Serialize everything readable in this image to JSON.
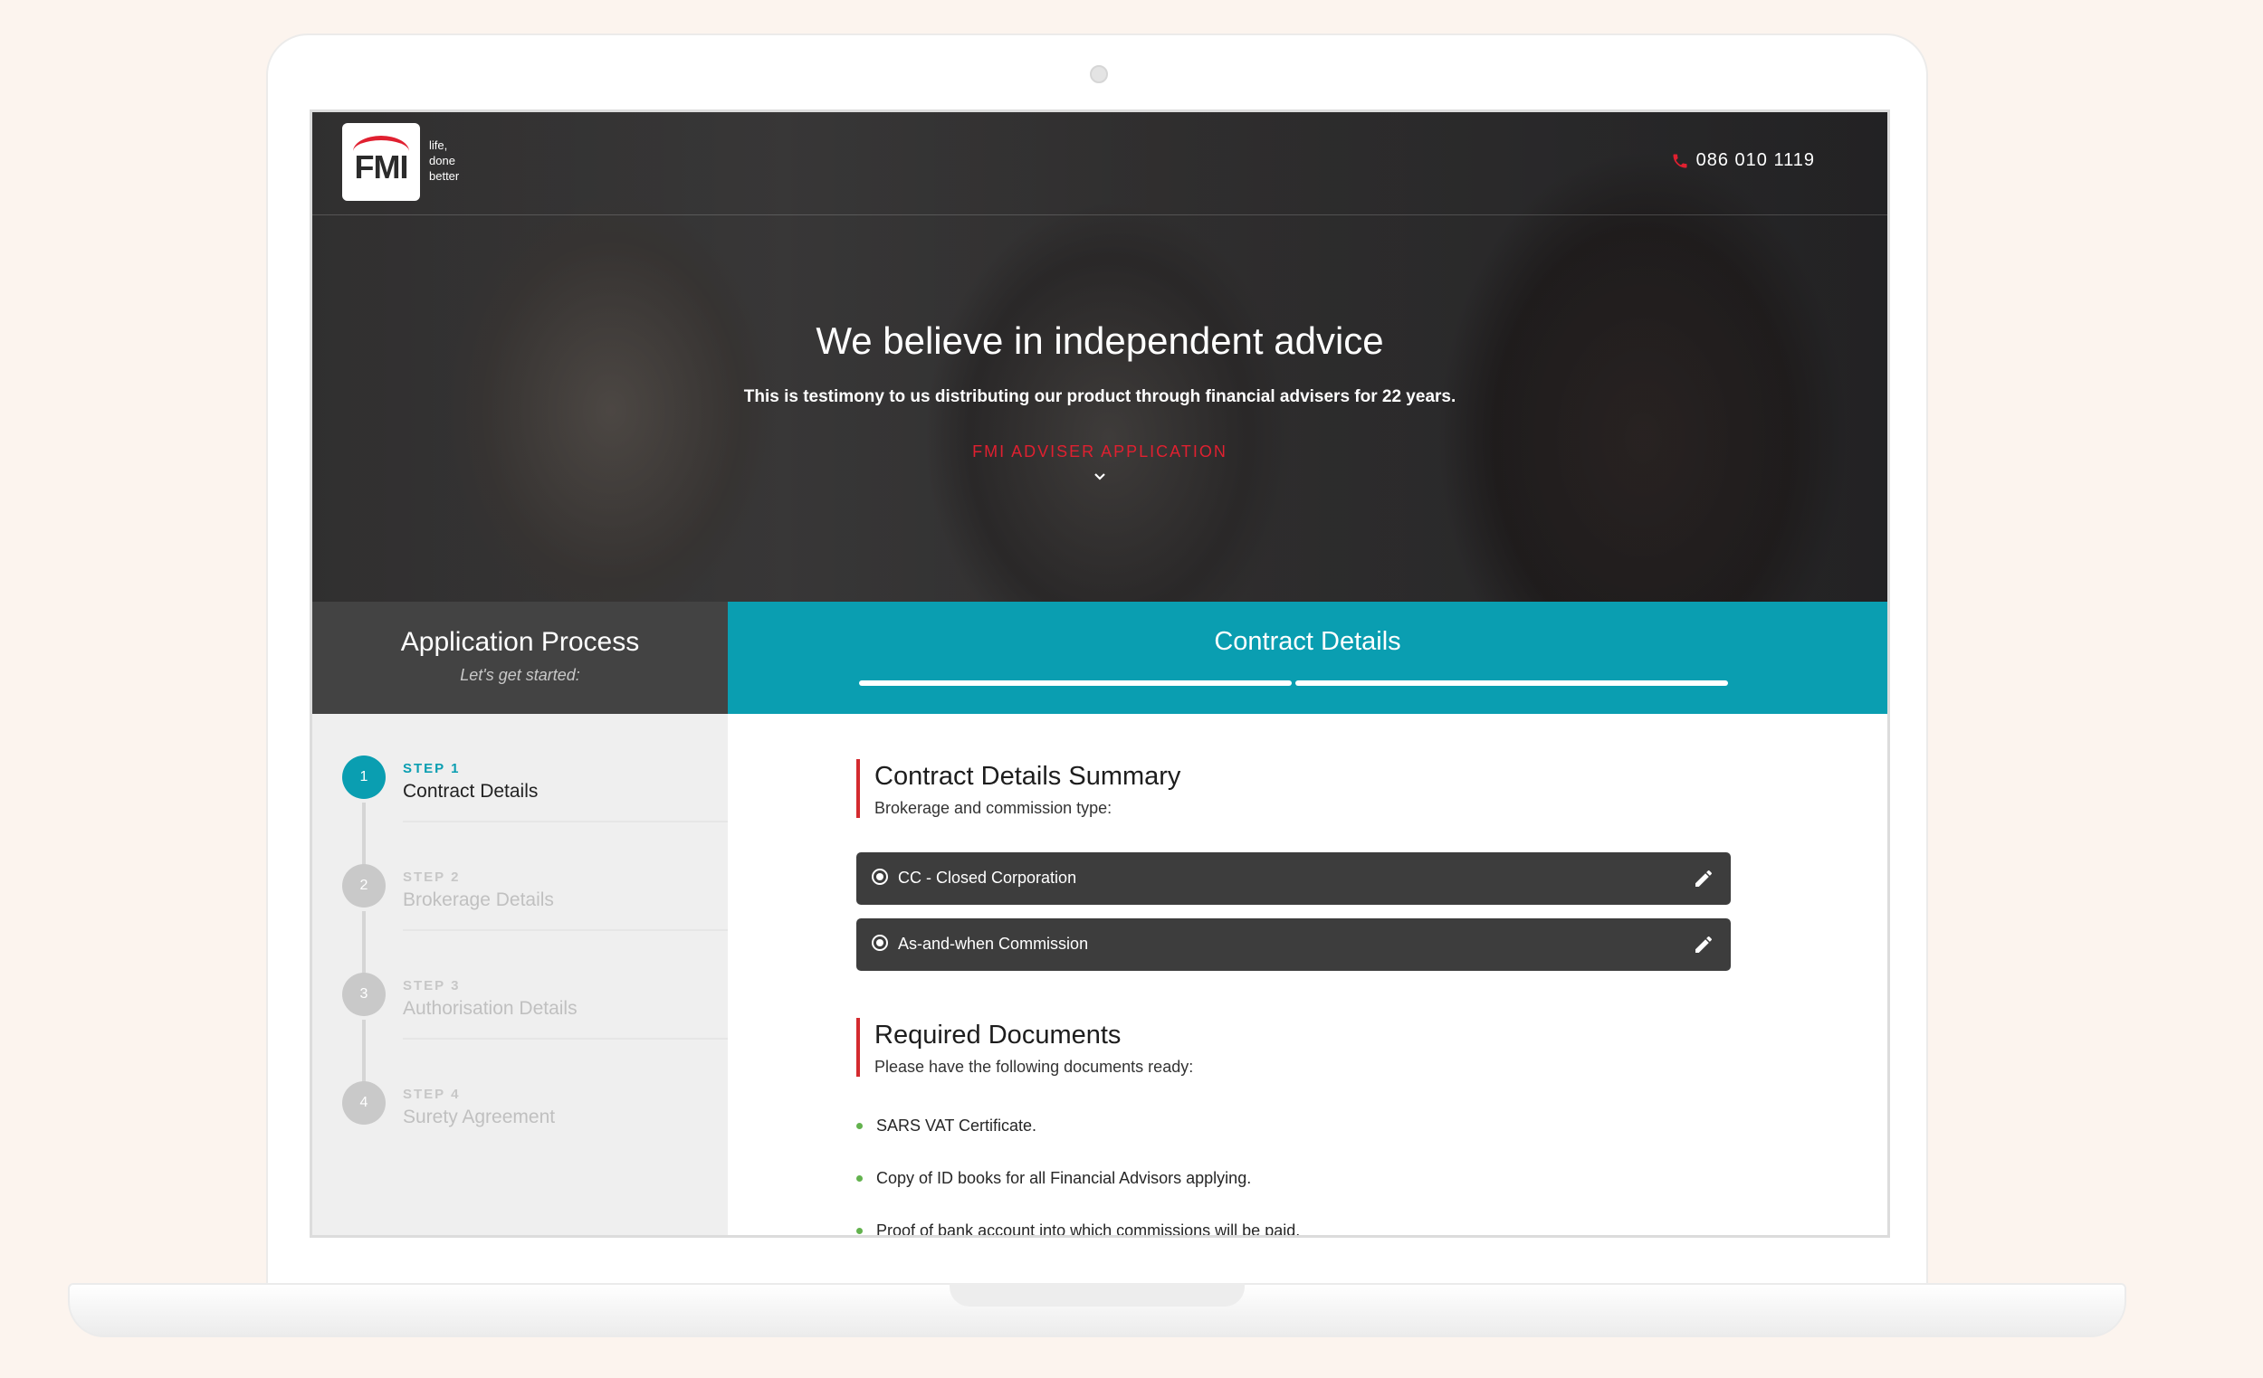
{
  "brand": {
    "logo_text": "FMI",
    "tagline": [
      "life,",
      "done",
      "better"
    ],
    "accent": "#e02030",
    "teal": "#0a9eb1"
  },
  "header": {
    "phone": "086 010 1119",
    "phone_icon": "phone-icon"
  },
  "hero": {
    "title": "We believe in independent advice",
    "subtitle": "This is testimony to us distributing our product through financial advisers for 22 years.",
    "cta": "FMI ADVISER APPLICATION",
    "cta_icon": "chevron-down-icon"
  },
  "process": {
    "title": "Application Process",
    "subtitle": "Let's get started:",
    "current_section": "Contract Details",
    "progress_segments": 2
  },
  "steps": [
    {
      "label": "STEP 1",
      "number": "1",
      "name": "Contract Details",
      "active": true
    },
    {
      "label": "STEP 2",
      "number": "2",
      "name": "Brokerage Details",
      "active": false
    },
    {
      "label": "STEP 3",
      "number": "3",
      "name": "Authorisation Details",
      "active": false
    },
    {
      "label": "STEP 4",
      "number": "4",
      "name": "Surety Agreement",
      "active": false
    }
  ],
  "summary": {
    "title": "Contract Details Summary",
    "description": "Brokerage and commission type:",
    "options": [
      {
        "text": "CC - Closed Corporation",
        "icon": "pencil-icon"
      },
      {
        "text": "As-and-when Commission",
        "icon": "pencil-icon"
      }
    ]
  },
  "documents": {
    "title": "Required Documents",
    "description": "Please have the following documents ready:",
    "items": [
      "SARS VAT Certificate.",
      "Copy of ID books for all Financial Advisors applying.",
      "Proof of bank account into which commissions will be paid."
    ]
  }
}
